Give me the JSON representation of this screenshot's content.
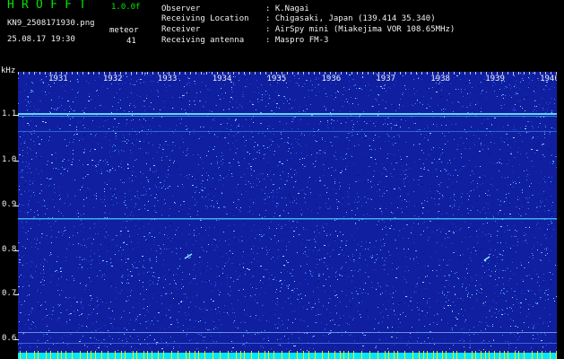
{
  "header": {
    "app_title": "HROFFT",
    "version": "1.0.0f",
    "filename": "KN9_2508171930.png",
    "datetime": "25.08.17 19:30",
    "counter_label": "meteor",
    "counter_value": "41"
  },
  "info": {
    "labels": [
      "Observer",
      "Receiving Location",
      "Receiver",
      "Receiving antenna"
    ],
    "values": [
      ": K.Nagai",
      ": Chigasaki, Japan (139.414 35.340)",
      ": AirSpy mini (Miakejima VOR 108.65MHz)",
      ": Maspro FM-3"
    ]
  },
  "axis": {
    "unit": "kHz",
    "y_labels": [
      "1.1",
      "1.0",
      "0.9",
      "0.8",
      "0.7",
      "0.6"
    ],
    "time_labels": [
      "1931",
      "1932",
      "1933",
      "1934",
      "1935",
      "1936",
      "1937",
      "1938",
      "1939",
      "1940"
    ]
  },
  "colors": {
    "background": "#000000",
    "spectrogram_base": "#0f1fa0",
    "title_green": "#00e800",
    "text": "#f0f0f0",
    "signal_cyan": "#7fffff",
    "bottom_bar": "#00e8ff",
    "tick_yellow": "#f0f000"
  }
}
